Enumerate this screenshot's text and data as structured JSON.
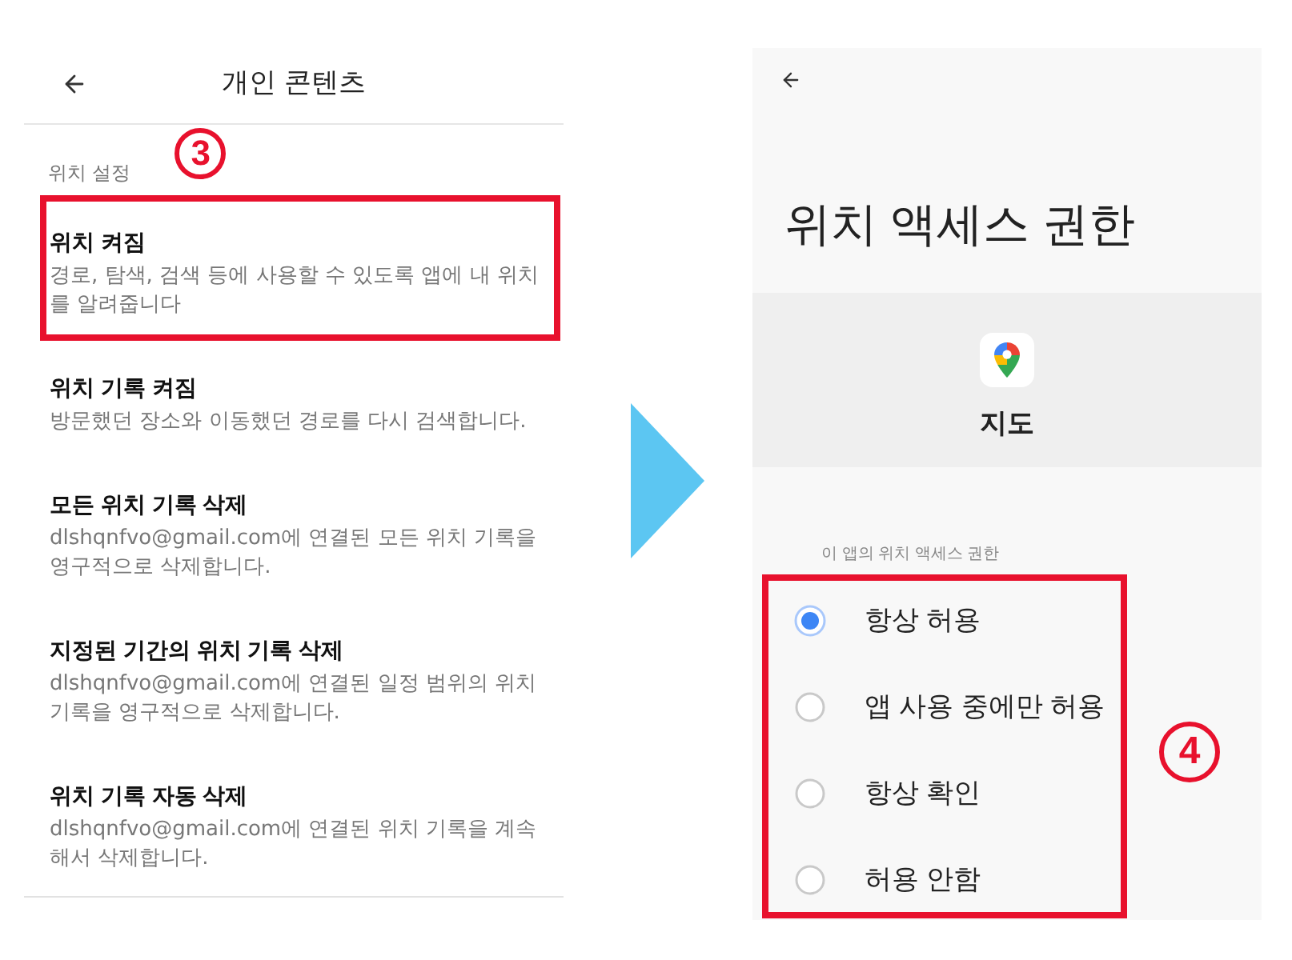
{
  "left_screen": {
    "title": "개인 콘텐츠",
    "step_badge": "3",
    "section_label": "위치 설정",
    "items": [
      {
        "title": "위치 켜짐",
        "description": "경로, 탐색, 검색 등에 사용할 수 있도록 앱에 내 위치를 알려줍니다",
        "highlighted": true
      },
      {
        "title": "위치 기록 켜짐",
        "description": "방문했던 장소와 이동했던 경로를 다시 검색합니다.",
        "highlighted": false
      },
      {
        "title": "모든 위치 기록 삭제",
        "description": "dlshqnfvo@gmail.com에 연결된 모든 위치 기록을 영구적으로 삭제합니다.",
        "highlighted": false
      },
      {
        "title": "지정된 기간의 위치 기록 삭제",
        "description": "dlshqnfvo@gmail.com에 연결된 일정 범위의 위치 기록을 영구적으로 삭제합니다.",
        "highlighted": false
      },
      {
        "title": "위치 기록 자동 삭제",
        "description": "dlshqnfvo@gmail.com에 연결된 위치 기록을 계속해서 삭제합니다.",
        "highlighted": false
      }
    ]
  },
  "right_screen": {
    "title": "위치 액세스 권한",
    "app": {
      "name": "지도"
    },
    "group_label": "이 앱의 위치 액세스 권한",
    "options_highlighted": true,
    "step_badge": "4",
    "options": [
      {
        "label": "항상 허용",
        "selected": true
      },
      {
        "label": "앱 사용 중에만 허용",
        "selected": false
      },
      {
        "label": "항상 확인",
        "selected": false
      },
      {
        "label": "허용 안함",
        "selected": false
      }
    ]
  }
}
